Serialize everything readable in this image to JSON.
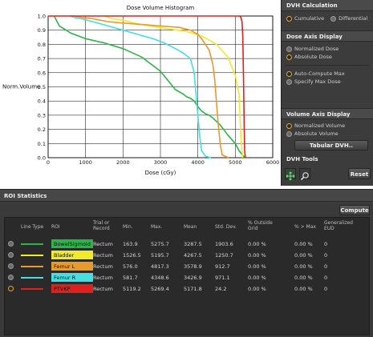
{
  "chart_data": {
    "type": "line",
    "title": "Dose Volume Histogram",
    "xlabel": "Dose (cGy)",
    "ylabel": "Norm.Volume",
    "xlim": [
      0,
      6000
    ],
    "ylim": [
      0,
      1.0
    ],
    "x_ticks": [
      "0",
      "1000",
      "2000",
      "3000",
      "4000",
      "5000",
      "6000"
    ],
    "y_ticks": [
      "0.0",
      "0.1",
      "0.2",
      "0.3",
      "0.4",
      "0.5",
      "0.6",
      "0.7",
      "0.8",
      "0.9",
      "1.0"
    ],
    "grid": true,
    "series": [
      {
        "name": "BowelSigmoid",
        "color": "#2db34a",
        "x": [
          160,
          300,
          600,
          1000,
          1500,
          2000,
          2500,
          3000,
          3400,
          3600,
          3700,
          3800,
          3900,
          4000,
          4100,
          4200,
          4300,
          4400,
          4600,
          4800,
          5000,
          5100,
          5200,
          5276
        ],
        "y": [
          1.0,
          0.93,
          0.88,
          0.84,
          0.81,
          0.77,
          0.71,
          0.61,
          0.48,
          0.45,
          0.43,
          0.42,
          0.4,
          0.36,
          0.33,
          0.31,
          0.3,
          0.28,
          0.23,
          0.16,
          0.1,
          0.05,
          0.015,
          0.0
        ]
      },
      {
        "name": "Bladder",
        "color": "#f1ea2a",
        "x": [
          1526,
          1700,
          2000,
          2300,
          2700,
          3200,
          3700,
          4100,
          4500,
          4800,
          5000,
          5100,
          5150,
          5196
        ],
        "y": [
          1.0,
          0.98,
          0.97,
          0.95,
          0.93,
          0.91,
          0.89,
          0.86,
          0.8,
          0.71,
          0.58,
          0.45,
          0.15,
          0.0
        ]
      },
      {
        "name": "Femur L",
        "color": "#e99a2a",
        "x": [
          576,
          700,
          900,
          1200,
          1600,
          2000,
          2500,
          3000,
          3500,
          3800,
          4000,
          4100,
          4200,
          4300,
          4400,
          4450,
          4500,
          4550,
          4600,
          4650,
          4817
        ],
        "y": [
          1.0,
          1.0,
          0.99,
          0.98,
          0.96,
          0.95,
          0.94,
          0.93,
          0.92,
          0.9,
          0.87,
          0.84,
          0.8,
          0.76,
          0.66,
          0.55,
          0.38,
          0.22,
          0.09,
          0.02,
          0.0
        ]
      },
      {
        "name": "Femur R",
        "color": "#45dfe3",
        "x": [
          582,
          700,
          900,
          1200,
          1600,
          2000,
          2400,
          2800,
          3100,
          3400,
          3600,
          3800,
          3900,
          3950,
          4000,
          4050,
          4100,
          4200,
          4349
        ],
        "y": [
          1.0,
          0.99,
          0.98,
          0.96,
          0.93,
          0.9,
          0.87,
          0.84,
          0.81,
          0.77,
          0.74,
          0.7,
          0.6,
          0.45,
          0.3,
          0.15,
          0.05,
          0.01,
          0.0
        ]
      },
      {
        "name": "PTVKP",
        "color": "#e0201c",
        "x": [
          0,
          5100,
          5119,
          5150,
          5180,
          5200,
          5220,
          5240,
          5250,
          5269
        ],
        "y": [
          1.0,
          1.0,
          1.0,
          0.99,
          0.96,
          0.85,
          0.55,
          0.2,
          0.05,
          0.0
        ]
      }
    ]
  },
  "right_panel": {
    "dvh_calc": {
      "title": "DVH Calculation",
      "options": [
        "Cumulative",
        "Differential"
      ],
      "selected": "Cumulative"
    },
    "dose_axis": {
      "title": "Dose Axis Display",
      "options": [
        "Normalized Dose",
        "Absolute Dose"
      ],
      "selected": "Absolute Dose",
      "options2": [
        "Auto-Compute Max",
        "Specify Max Dose"
      ],
      "selected2": "Auto-Compute Max"
    },
    "volume_axis": {
      "title": "Volume Axis Display",
      "options": [
        "Normalized Volume",
        "Absolute Volume"
      ],
      "selected": "Normalized Volume",
      "tabular_button": "Tabular DVH.."
    },
    "dvh_tools": {
      "title": "DVH Tools",
      "reset_button": "Reset",
      "icons": [
        "pan-tool-icon",
        "zoom-tool-icon"
      ]
    }
  },
  "roi_statistics": {
    "title": "ROI Statistics",
    "compute_button": "Compute",
    "headers": [
      "Line Type",
      "ROI",
      "Trial or Record",
      "Min.",
      "Max.",
      "Mean",
      "Std. Dev.",
      "% Outside Grid",
      "% > Max",
      "Generalized EUD"
    ],
    "rows": [
      {
        "roi": "BowelSigmoid",
        "color": "#2db34a",
        "line_color": "#2db34a",
        "trial": "Rectum",
        "min": "163.9",
        "max": "5275.7",
        "mean": "3287.5",
        "std": "1903.6",
        "outside": "0.00 %",
        "gt_max": "0.00 %",
        "eud": "0",
        "selected": false
      },
      {
        "roi": "Bladder",
        "color": "#f1ea2a",
        "line_color": "#f1ea2a",
        "trial": "Rectum",
        "min": "1526.5",
        "max": "5195.7",
        "mean": "4267.5",
        "std": "1250.7",
        "outside": "0.00 %",
        "gt_max": "0.00 %",
        "eud": "0",
        "selected": false
      },
      {
        "roi": "Femur L",
        "color": "#e99a2a",
        "line_color": "#e99a2a",
        "trial": "Rectum",
        "min": "576.0",
        "max": "4817.3",
        "mean": "3578.9",
        "std": "912.7",
        "outside": "0.00 %",
        "gt_max": "0.00 %",
        "eud": "0",
        "selected": false
      },
      {
        "roi": "Femur R",
        "color": "#45dfe3",
        "line_color": "#45dfe3",
        "trial": "Rectum",
        "min": "581.7",
        "max": "4348.6",
        "mean": "3426.9",
        "std": "971.1",
        "outside": "0.00 %",
        "gt_max": "0.00 %",
        "eud": "0",
        "selected": false
      },
      {
        "roi": "PTVKP",
        "color": "#e0201c",
        "line_color": "#e0201c",
        "trial": "Rectum",
        "min": "5119.2",
        "max": "5269.4",
        "mean": "5171.8",
        "std": "24.2",
        "outside": "0.00 %",
        "gt_max": "0.00 %",
        "eud": "0",
        "selected": true
      }
    ]
  }
}
